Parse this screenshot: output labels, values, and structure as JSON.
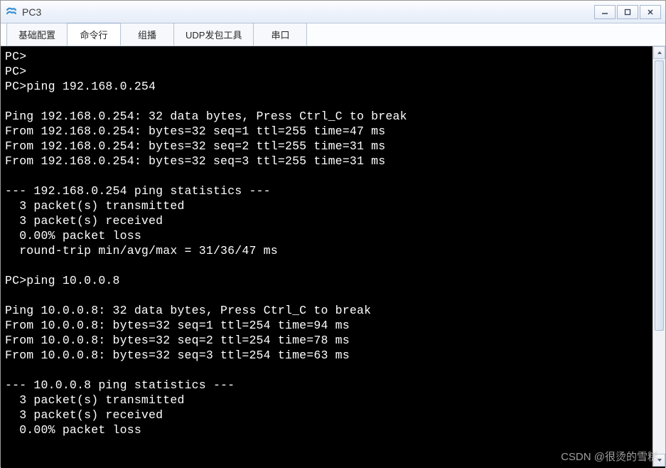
{
  "window": {
    "title": "PC3",
    "min": "—",
    "max": "▢",
    "close": "✕"
  },
  "tabs": [
    {
      "label": "基础配置",
      "active": false
    },
    {
      "label": "命令行",
      "active": true
    },
    {
      "label": "组播",
      "active": false
    },
    {
      "label": "UDP发包工具",
      "active": false
    },
    {
      "label": "串口",
      "active": false
    }
  ],
  "terminal": {
    "lines": [
      "PC>",
      "PC>",
      "PC>ping 192.168.0.254",
      "",
      "Ping 192.168.0.254: 32 data bytes, Press Ctrl_C to break",
      "From 192.168.0.254: bytes=32 seq=1 ttl=255 time=47 ms",
      "From 192.168.0.254: bytes=32 seq=2 ttl=255 time=31 ms",
      "From 192.168.0.254: bytes=32 seq=3 ttl=255 time=31 ms",
      "",
      "--- 192.168.0.254 ping statistics ---",
      "  3 packet(s) transmitted",
      "  3 packet(s) received",
      "  0.00% packet loss",
      "  round-trip min/avg/max = 31/36/47 ms",
      "",
      "PC>ping 10.0.0.8",
      "",
      "Ping 10.0.0.8: 32 data bytes, Press Ctrl_C to break",
      "From 10.0.0.8: bytes=32 seq=1 ttl=254 time=94 ms",
      "From 10.0.0.8: bytes=32 seq=2 ttl=254 time=78 ms",
      "From 10.0.0.8: bytes=32 seq=3 ttl=254 time=63 ms",
      "",
      "--- 10.0.0.8 ping statistics ---",
      "  3 packet(s) transmitted",
      "  3 packet(s) received",
      "  0.00% packet loss"
    ]
  },
  "watermark": "CSDN @很烫的雪糕"
}
